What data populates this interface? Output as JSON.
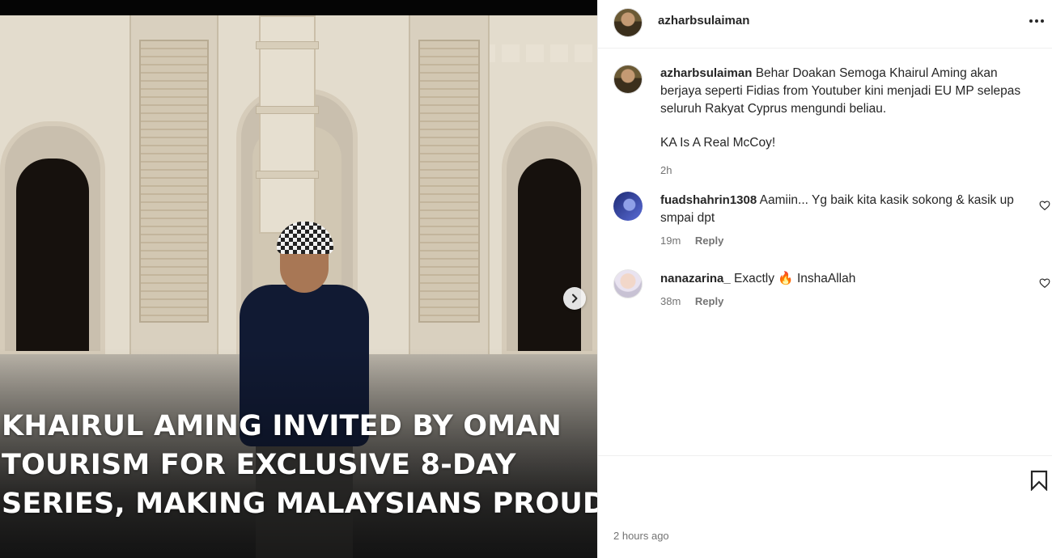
{
  "post": {
    "headline": [
      "KHAIRUL AMING INVITED BY OMAN",
      "TOURISM FOR EXCLUSIVE 8-DAY",
      "SERIES, MAKING MALAYSIANS PROUD"
    ],
    "author": "azharbsulaiman",
    "posted_ago": "2 hours ago"
  },
  "caption": {
    "username": "azharbsulaiman",
    "text": "Behar Doakan Semoga Khairul Aming akan berjaya seperti Fidias from Youtuber kini menjadi EU MP selepas seluruh Rakyat Cyprus mengundi beliau.",
    "text2": "KA Is A Real McCoy!",
    "time": "2h"
  },
  "comments": [
    {
      "username": "fuadshahrin1308",
      "text": "Aamiin... Yg baik kita kasik sokong & kasik up smpai dpt",
      "time": "19m",
      "reply_label": "Reply"
    },
    {
      "username": "nanazarina_",
      "text_before": "Exactly",
      "emoji": "🔥",
      "text_after": "InshaAllah",
      "time": "38m",
      "reply_label": "Reply"
    }
  ],
  "icons": {
    "more": "more-options-icon",
    "next": "chevron-right-icon",
    "heart": "heart-outline-icon",
    "bookmark": "bookmark-icon"
  },
  "colors": {
    "text": "#262626",
    "secondary": "#737373",
    "border": "#efefef"
  }
}
